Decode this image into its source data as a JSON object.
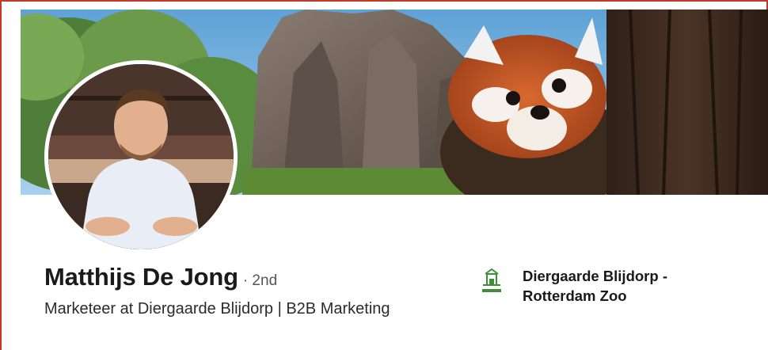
{
  "profile": {
    "name": "Matthijs De Jong",
    "degree": "· 2nd",
    "headline": "Marketeer at Diergaarde Blijdorp | B2B Marketing"
  },
  "company": {
    "name": "Diergaarde Blijdorp - Rotterdam Zoo",
    "logo_icon": "zoo-logo-icon",
    "logo_color": "#3f8f3a"
  },
  "banner": {
    "subject": "red panda with rocks and trees"
  },
  "colors": {
    "border_accent": "#c0392b",
    "text_primary": "#1a1a1a",
    "text_secondary": "#555555"
  }
}
